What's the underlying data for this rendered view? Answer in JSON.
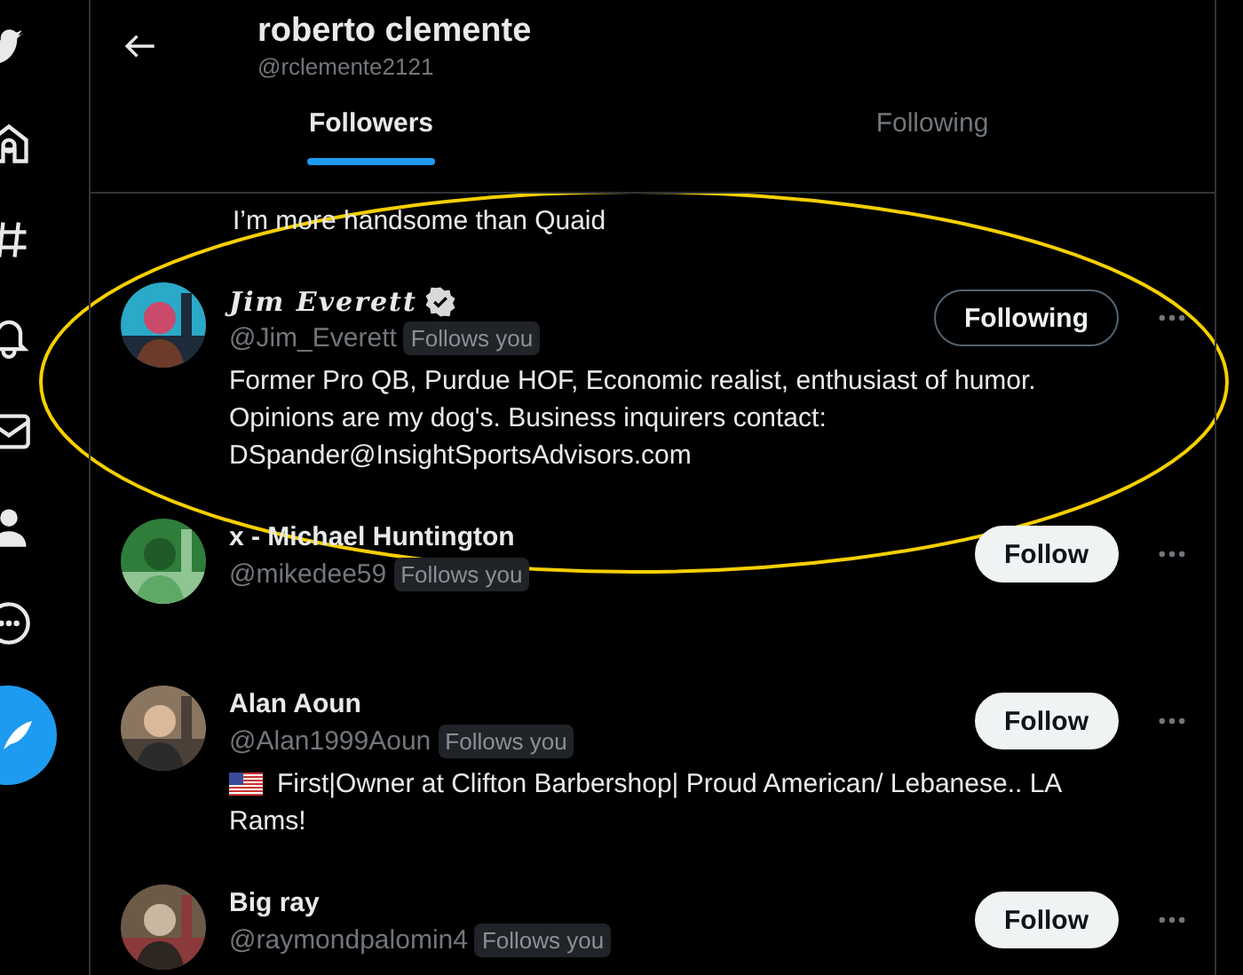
{
  "header": {
    "title": "roberto clemente",
    "handle": "@rclemente2121"
  },
  "tabs": [
    {
      "label": "Followers",
      "selected": true
    },
    {
      "label": "Following",
      "selected": false
    }
  ],
  "hidden_row": {
    "bio": "I’m more handsome than Quaid"
  },
  "users": [
    {
      "name": "Jim Everett",
      "script_name": true,
      "verified": true,
      "handle": "@Jim_Everett",
      "badge": "Follows you",
      "button": "Following",
      "following": true,
      "bio": [
        "Former Pro QB, Purdue HOF, Economic realist, enthusiast of humor.",
        "Opinions are my dog's. Business inquirers contact:",
        "DSpander@InsightSportsAdvisors.com"
      ]
    },
    {
      "name": "x - Michael Huntington",
      "script_name": false,
      "verified": false,
      "handle": "@mikedee59",
      "badge": "Follows you",
      "button": "Follow",
      "following": false
    },
    {
      "name": "Alan Aoun",
      "script_name": false,
      "verified": false,
      "handle": "@Alan1999Aoun",
      "badge": "Follows you",
      "button": "Follow",
      "following": false,
      "bio_flag": true,
      "bio": [
        "First|Owner at Clifton Barbershop| Proud American/ Lebanese.. LA",
        "Rams!"
      ]
    },
    {
      "name": "Big ray",
      "script_name": false,
      "verified": false,
      "handle": "@raymondpalomin4",
      "badge": "Follows you",
      "button": "Follow",
      "following": false
    }
  ],
  "annotation": {
    "kind": "ellipse"
  }
}
